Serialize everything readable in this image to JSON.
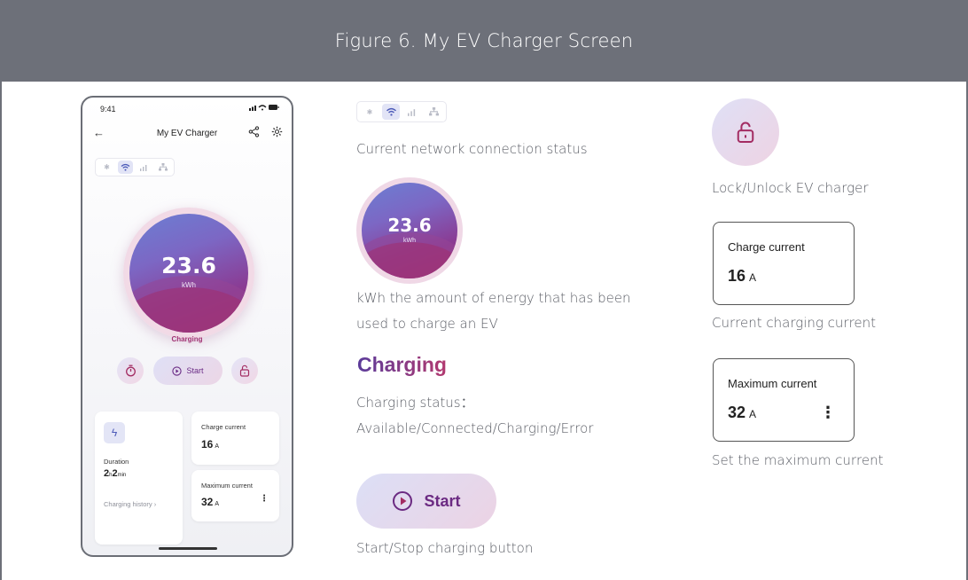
{
  "figure": {
    "title": "Figure 6. My EV Charger Screen"
  },
  "phone": {
    "status_time": "9:41",
    "nav_title": "My EV Charger",
    "energy_value": "23.6",
    "energy_unit": "kWh",
    "status_text": "Charging",
    "start_label": "Start",
    "duration_label": "Duration",
    "duration_hours": "2",
    "duration_hours_unit": "h",
    "duration_minutes": "2",
    "duration_minutes_unit": "min",
    "history_link": "Charging history",
    "charge_current_label": "Charge current",
    "charge_current_value": "16",
    "charge_current_unit": "A",
    "max_current_label": "Maximum current",
    "max_current_value": "32",
    "max_current_unit": "A"
  },
  "network_icons": [
    "bluetooth-icon",
    "wifi-icon",
    "cellular-icon",
    "ethernet-icon"
  ],
  "network_active": "wifi-icon",
  "legend": {
    "network_caption": "Current network connection status",
    "energy_value": "23.6",
    "energy_unit": "kWh",
    "energy_caption_line1": "kWh the amount of energy that has been",
    "energy_caption_line2": "used to charge an EV",
    "charging_title": "Charging",
    "charging_caption_line1": "Charging status：",
    "charging_caption_line2": "Available/Connected/Charging/Error",
    "start_label": "Start",
    "start_caption": "Start/Stop charging button",
    "lock_caption": "Lock/Unlock EV charger",
    "charge_current_label": "Charge current",
    "charge_current_value": "16",
    "charge_current_unit": "A",
    "charge_current_caption": "Current charging current",
    "max_current_label": "Maximum current",
    "max_current_value": "32",
    "max_current_unit": "A",
    "max_current_caption": "Set the maximum current"
  },
  "colors": {
    "header_bg": "#6d7079",
    "accent_magenta": "#a32c62",
    "accent_purple": "#6b2a82"
  }
}
